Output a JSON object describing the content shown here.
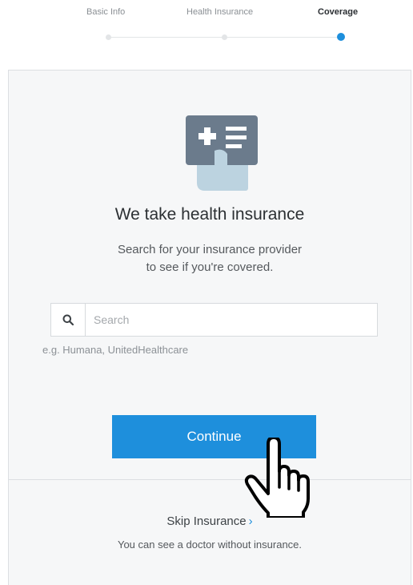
{
  "stepper": {
    "steps": [
      {
        "label": "Basic Info",
        "state": "done"
      },
      {
        "label": "Health Insurance",
        "state": "done"
      },
      {
        "label": "Coverage",
        "state": "active"
      }
    ]
  },
  "card": {
    "title": "We take health insurance",
    "subtitle_line1": "Search for your insurance provider",
    "subtitle_line2": "to see if you're covered.",
    "icon": "insurance-card-icon"
  },
  "search": {
    "placeholder": "Search",
    "value": "",
    "hint": "e.g. Humana, UnitedHealthcare",
    "icon": "search-icon"
  },
  "actions": {
    "continue_label": "Continue",
    "skip_label": "Skip Insurance",
    "skip_chevron": "›",
    "skip_note": "You can see a doctor without insurance."
  },
  "colors": {
    "accent": "#1e8fdc",
    "card_bg": "#f6f7f8",
    "icon_gray": "#6b7b8c",
    "icon_light": "#bcd3e0"
  },
  "cursor": "hand-pointer-icon"
}
